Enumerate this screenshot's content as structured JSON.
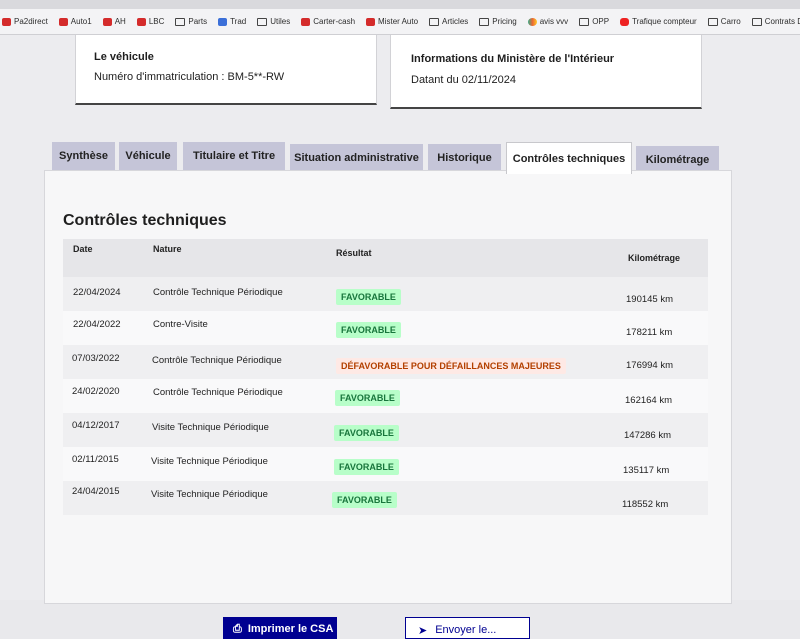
{
  "bookmarks": [
    {
      "label": "Pa2direct",
      "icon": "red"
    },
    {
      "label": "Auto1",
      "icon": "red"
    },
    {
      "label": "AH",
      "icon": "red"
    },
    {
      "label": "LBC",
      "icon": "red"
    },
    {
      "label": "Parts",
      "icon": "folder"
    },
    {
      "label": "Trad",
      "icon": "blue"
    },
    {
      "label": "Utiles",
      "icon": "folder"
    },
    {
      "label": "Carter-cash",
      "icon": "red"
    },
    {
      "label": "Mister Auto",
      "icon": "red"
    },
    {
      "label": "Articles",
      "icon": "folder"
    },
    {
      "label": "Pricing",
      "icon": "folder"
    },
    {
      "label": "avis vvv",
      "icon": "multi"
    },
    {
      "label": "OPP",
      "icon": "folder"
    },
    {
      "label": "Trafique compteur",
      "icon": "yt"
    },
    {
      "label": "Carro",
      "icon": "folder"
    },
    {
      "label": "Contrats Dista",
      "icon": "folder"
    }
  ],
  "vehicle": {
    "title": "Le véhicule",
    "plate": "Numéro d'immatriculation : BM-5**-RW"
  },
  "ministry": {
    "title": "Informations du Ministère de l'Intérieur",
    "date": "Datant du 02/11/2024"
  },
  "tabs": [
    "Synthèse",
    "Véhicule",
    "Titulaire et Titre",
    "Situation administrative",
    "Historique",
    "Contrôles techniques",
    "Kilométrage"
  ],
  "active_tab": "Contrôles techniques",
  "section_title": "Contrôles techniques",
  "table": {
    "headers": {
      "date": "Date",
      "nature": "Nature",
      "result": "Résultat",
      "km": "Kilométrage"
    },
    "rows": [
      {
        "date": "22/04/2024",
        "nature": "Contrôle Technique Périodique",
        "result": "FAVORABLE",
        "status": "fav",
        "km": "190145 km"
      },
      {
        "date": "22/04/2022",
        "nature": "Contre-Visite",
        "result": "FAVORABLE",
        "status": "fav",
        "km": "178211 km"
      },
      {
        "date": "07/03/2022",
        "nature": "Contrôle Technique Périodique",
        "result": "DÉFAVORABLE POUR DÉFAILLANCES MAJEURES",
        "status": "defav",
        "km": "176994 km"
      },
      {
        "date": "24/02/2020",
        "nature": "Contrôle Technique Périodique",
        "result": "FAVORABLE",
        "status": "fav",
        "km": "162164 km"
      },
      {
        "date": "04/12/2017",
        "nature": "Visite Technique Périodique",
        "result": "FAVORABLE",
        "status": "fav",
        "km": "147286 km"
      },
      {
        "date": "02/11/2015",
        "nature": "Visite Technique Périodique",
        "result": "FAVORABLE",
        "status": "fav",
        "km": "135117 km"
      },
      {
        "date": "24/04/2015",
        "nature": "Visite Technique Périodique",
        "result": "FAVORABLE",
        "status": "fav",
        "km": "118552 km"
      }
    ]
  },
  "buttons": {
    "print": "Imprimer le CSA",
    "send": "Envoyer le..."
  }
}
